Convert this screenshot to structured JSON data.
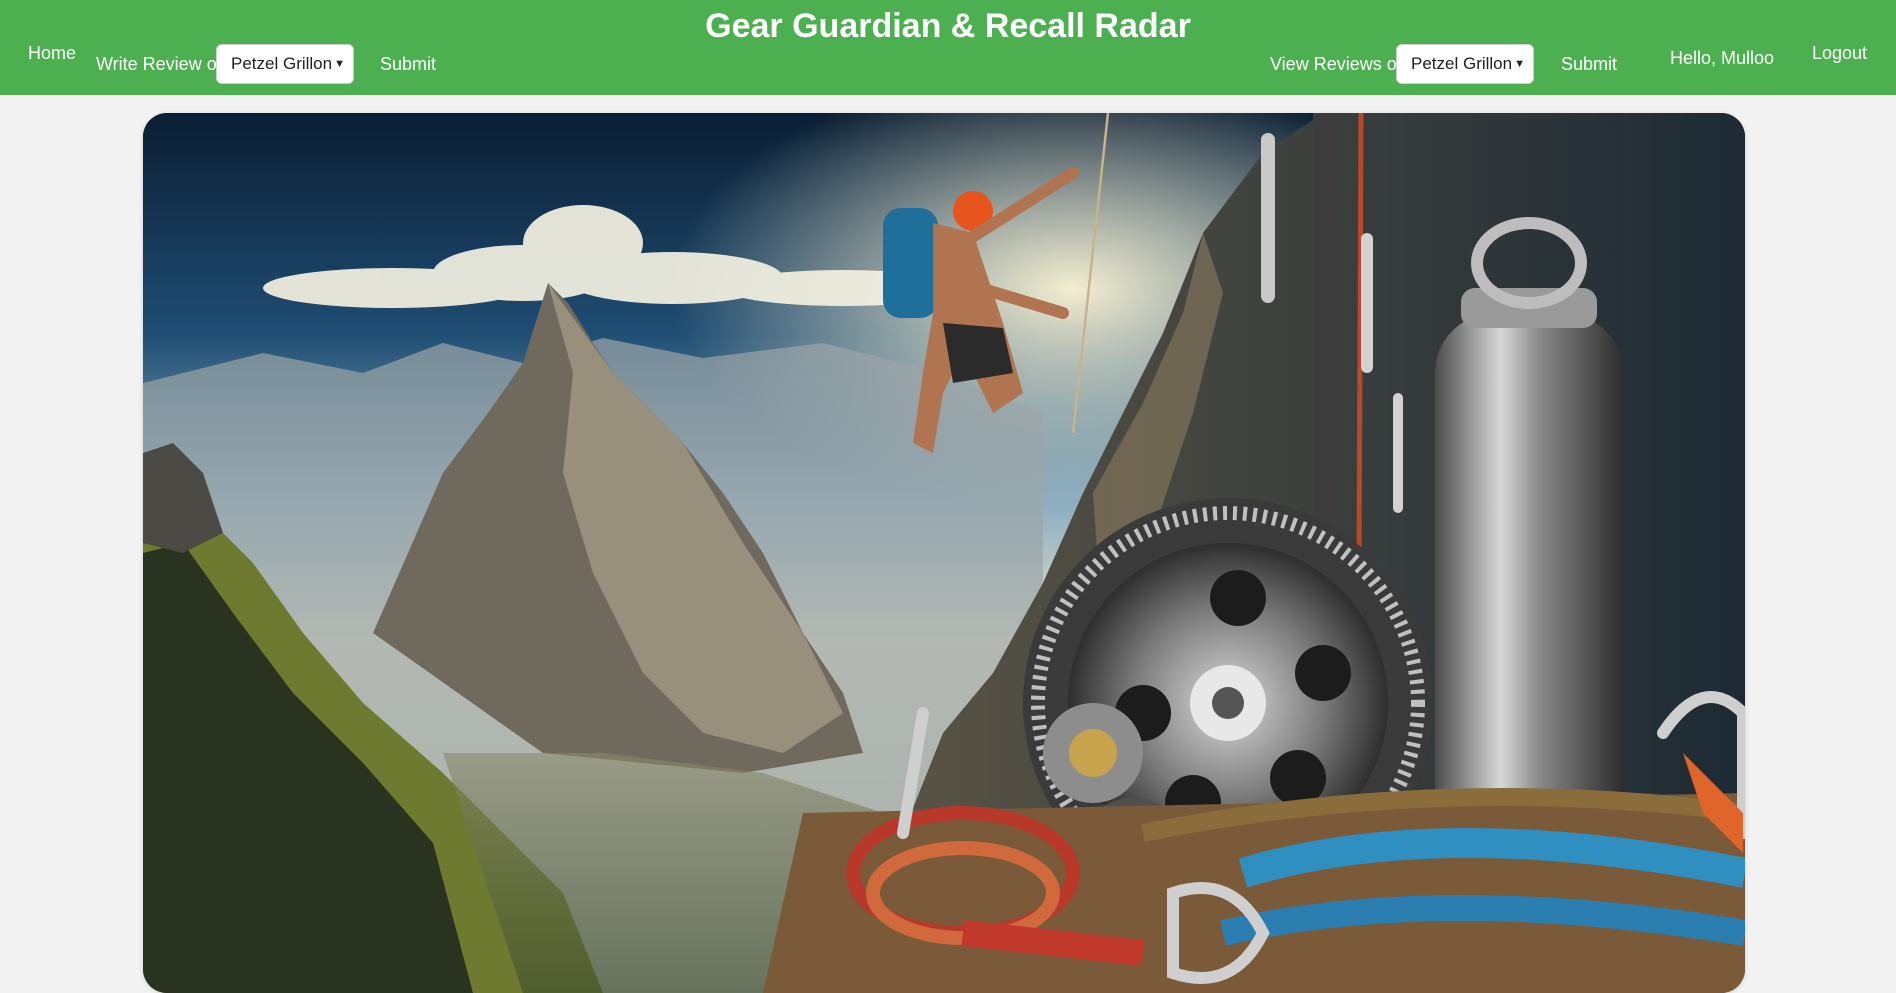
{
  "header": {
    "title": "Gear Guardian & Recall Radar",
    "home_label": "Home",
    "write_review_label": "Write Review of:",
    "write_review_selected": "Petzel Grillon",
    "write_submit_label": "Submit",
    "view_reviews_label": "View Reviews of:",
    "view_reviews_selected": "Petzel Grillon",
    "view_submit_label": "Submit",
    "greeting": "Hello, Mulloo",
    "logout_label": "Logout"
  },
  "hero": {
    "image_name": "climber-mountain-gear-hero-image"
  },
  "colors": {
    "header_bg": "#4caf50",
    "page_bg": "#f2f2f2",
    "header_text": "#ffffff"
  }
}
